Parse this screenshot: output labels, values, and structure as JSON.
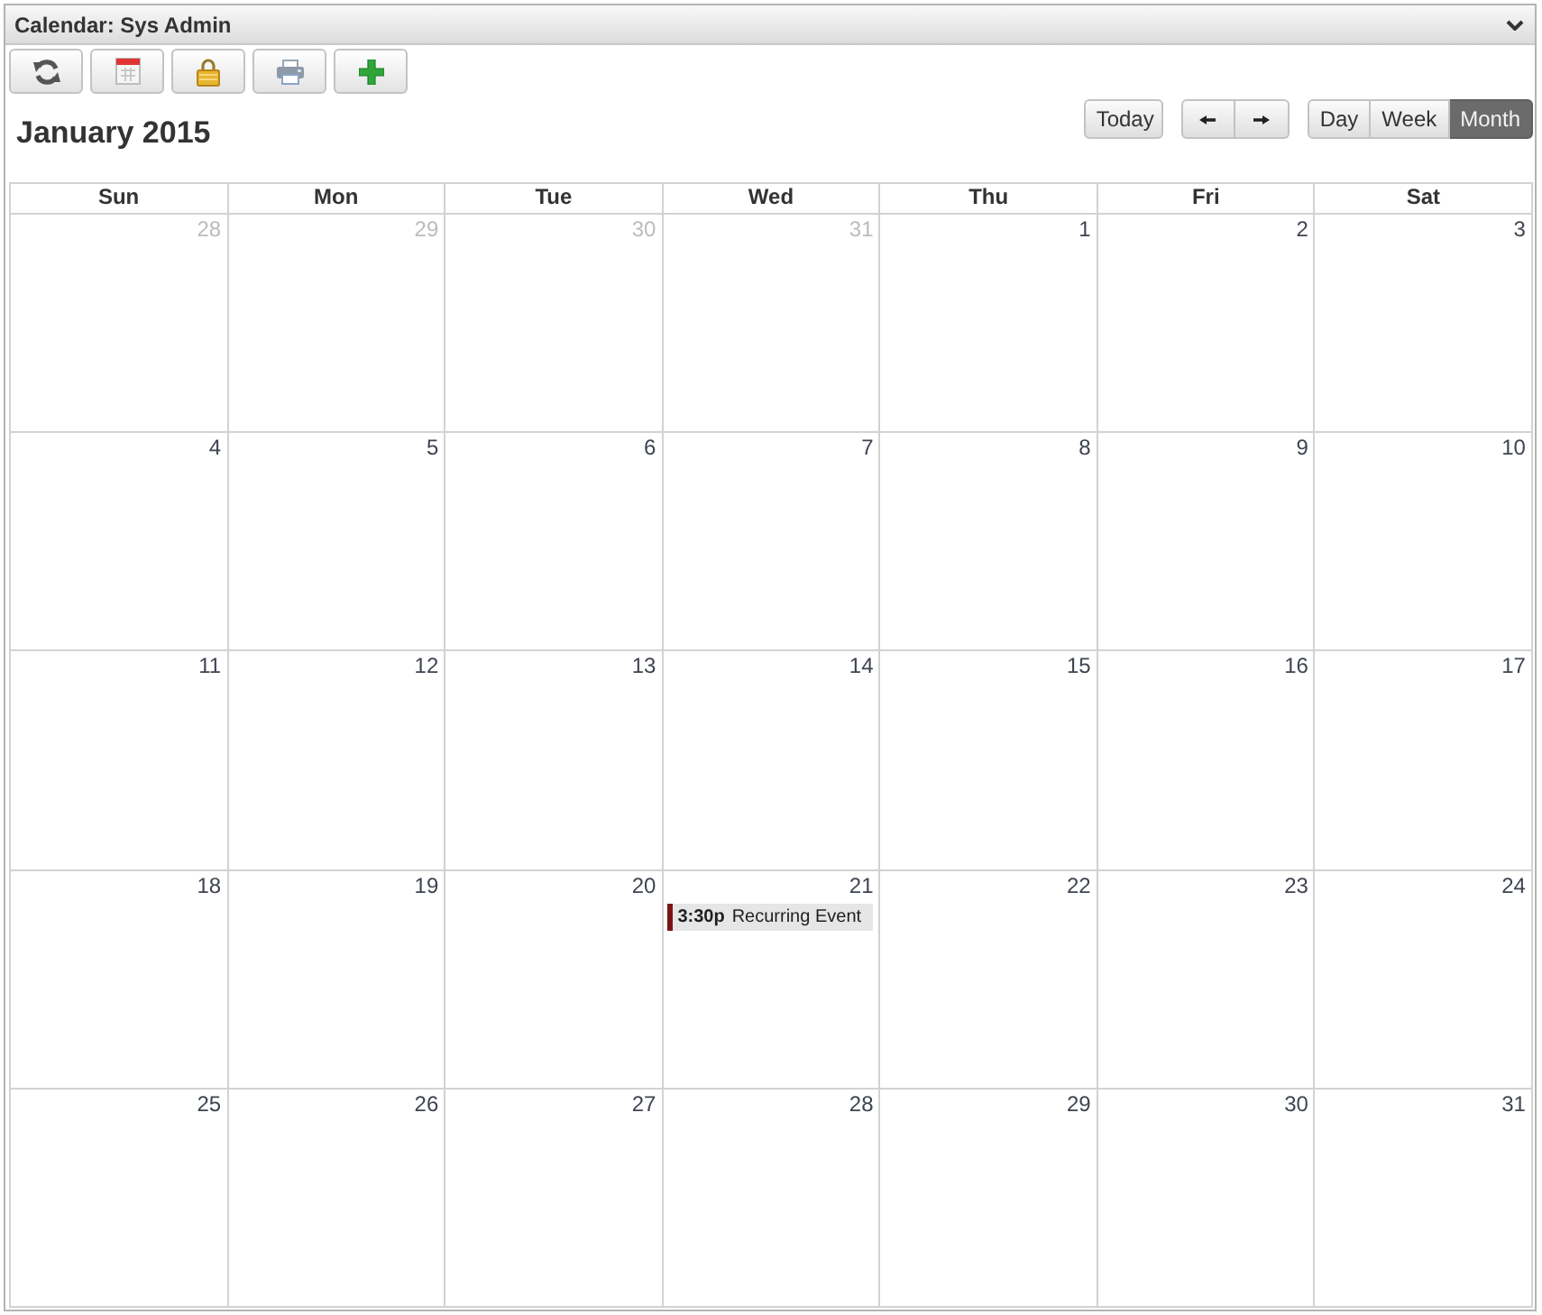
{
  "window": {
    "title": "Calendar: Sys Admin"
  },
  "heading": "January 2015",
  "today_button": "Today",
  "views": [
    {
      "label": "Day",
      "selected": false
    },
    {
      "label": "Week",
      "selected": false
    },
    {
      "label": "Month",
      "selected": true
    }
  ],
  "weekdays": [
    "Sun",
    "Mon",
    "Tue",
    "Wed",
    "Thu",
    "Fri",
    "Sat"
  ],
  "weeks": [
    {
      "days": [
        {
          "date": "28",
          "other_month": true
        },
        {
          "date": "29",
          "other_month": true
        },
        {
          "date": "30",
          "other_month": true
        },
        {
          "date": "31",
          "other_month": true
        },
        {
          "date": "1",
          "other_month": false
        },
        {
          "date": "2",
          "other_month": false
        },
        {
          "date": "3",
          "other_month": false
        }
      ]
    },
    {
      "days": [
        {
          "date": "4",
          "other_month": false
        },
        {
          "date": "5",
          "other_month": false
        },
        {
          "date": "6",
          "other_month": false
        },
        {
          "date": "7",
          "other_month": false
        },
        {
          "date": "8",
          "other_month": false
        },
        {
          "date": "9",
          "other_month": false
        },
        {
          "date": "10",
          "other_month": false
        }
      ]
    },
    {
      "days": [
        {
          "date": "11",
          "other_month": false
        },
        {
          "date": "12",
          "other_month": false
        },
        {
          "date": "13",
          "other_month": false
        },
        {
          "date": "14",
          "other_month": false
        },
        {
          "date": "15",
          "other_month": false
        },
        {
          "date": "16",
          "other_month": false
        },
        {
          "date": "17",
          "other_month": false
        }
      ]
    },
    {
      "days": [
        {
          "date": "18",
          "other_month": false
        },
        {
          "date": "19",
          "other_month": false
        },
        {
          "date": "20",
          "other_month": false
        },
        {
          "date": "21",
          "other_month": false,
          "events": [
            {
              "time": "3:30p",
              "title": "Recurring Event",
              "color": "#7b1416"
            }
          ]
        },
        {
          "date": "22",
          "other_month": false
        },
        {
          "date": "23",
          "other_month": false
        },
        {
          "date": "24",
          "other_month": false
        }
      ]
    },
    {
      "days": [
        {
          "date": "25",
          "other_month": false
        },
        {
          "date": "26",
          "other_month": false
        },
        {
          "date": "27",
          "other_month": false
        },
        {
          "date": "28",
          "other_month": false
        },
        {
          "date": "29",
          "other_month": false
        },
        {
          "date": "30",
          "other_month": false
        },
        {
          "date": "31",
          "other_month": false
        }
      ]
    }
  ]
}
